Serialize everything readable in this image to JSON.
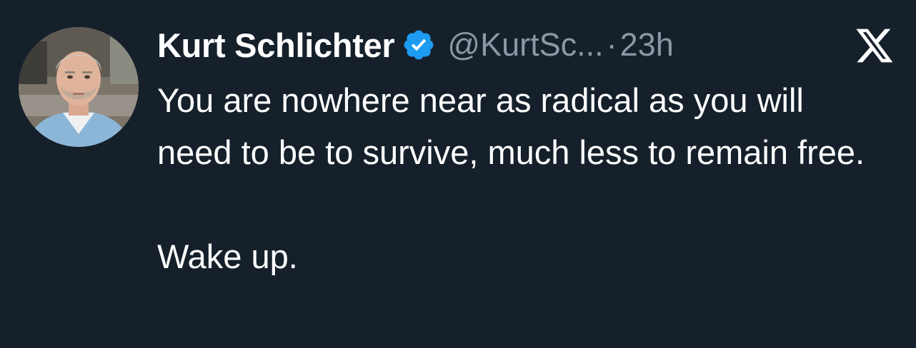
{
  "tweet": {
    "author_name": "Kurt Schlichter",
    "handle": "@KurtSc...",
    "separator": "·",
    "time": "23h",
    "verified": true,
    "text": "You are nowhere near as radical as you will need to be to survive, much less to remain free.\n\nWake up."
  },
  "icons": {
    "avatar": "profile-photo",
    "badge": "verified-badge-icon",
    "brand": "x-logo-icon"
  },
  "colors": {
    "background": "#15202b",
    "text": "#ffffff",
    "secondary_text": "#8b98a5",
    "verified_blue": "#1d9bf0"
  }
}
